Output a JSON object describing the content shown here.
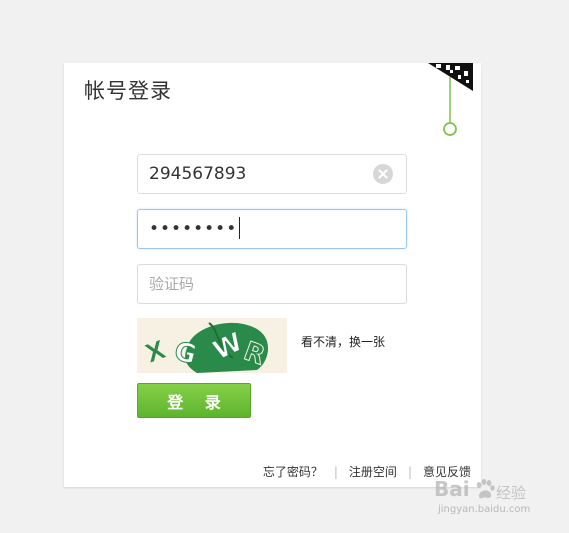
{
  "login": {
    "title": "帐号登录",
    "account": {
      "value": "294567893"
    },
    "password": {
      "masked_value": "••••••••"
    },
    "captcha": {
      "placeholder": "验证码",
      "image_text": "XGWR",
      "refresh_label": "看不清，换一张"
    },
    "submit_label": "登 录",
    "links": {
      "forgot": "忘了密码？",
      "register": "注册空间",
      "feedback": "意见反馈"
    },
    "separator": "|"
  },
  "watermark": {
    "brand": "Bai",
    "brand_cn": "经验",
    "url": "jingyan.baidu.com"
  },
  "colors": {
    "accent_green": "#6cc03a",
    "focus_border": "#9bc8ec",
    "captcha_green": "#2a8a4a"
  },
  "icons": {
    "clear": "clear-circle-icon",
    "qr": "qr-code-corner-icon"
  }
}
